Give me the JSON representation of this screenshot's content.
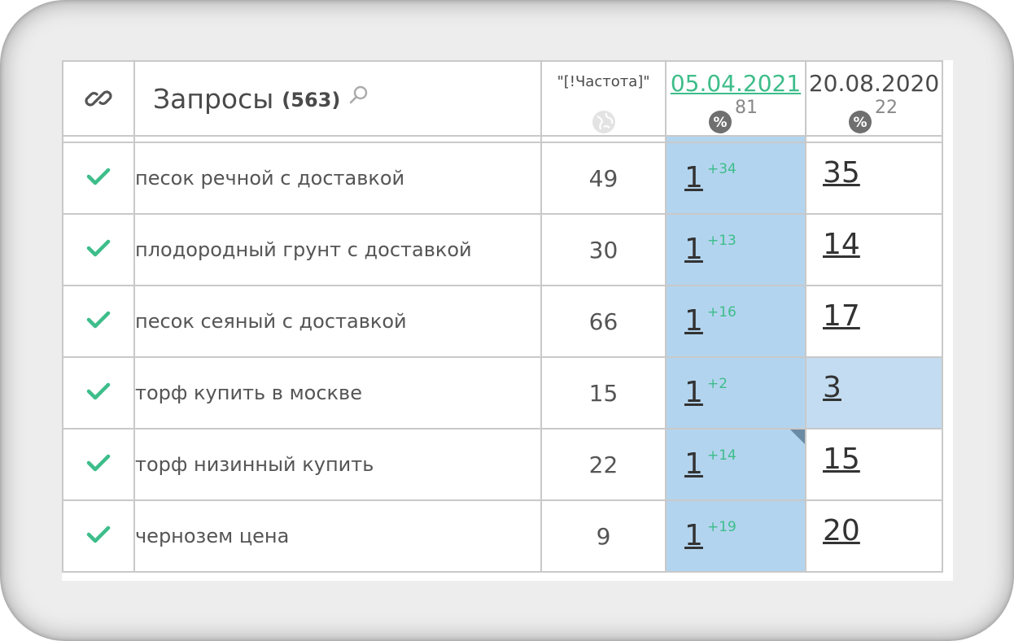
{
  "header": {
    "queries_title": "Запросы",
    "queries_count": "(563)",
    "frequency_label": "\"[!Частота]\"",
    "dates": [
      {
        "label": "05.04.2021",
        "percent": "81",
        "active": true
      },
      {
        "label": "20.08.2020",
        "percent": "22",
        "active": false
      }
    ]
  },
  "rows": [
    {
      "query": "песок речной с доставкой",
      "freq": "49",
      "pos1": "1",
      "delta": "+34",
      "pos2": "35"
    },
    {
      "query": "плодородный грунт с доставкой",
      "freq": "30",
      "pos1": "1",
      "delta": "+13",
      "pos2": "14"
    },
    {
      "query": "песок сеяный с доставкой",
      "freq": "66",
      "pos1": "1",
      "delta": "+16",
      "pos2": "17"
    },
    {
      "query": "торф купить в москве",
      "freq": "15",
      "pos1": "1",
      "delta": "+2",
      "pos2": "3"
    },
    {
      "query": "торф низинный купить",
      "freq": "22",
      "pos1": "1",
      "delta": "+14",
      "pos2": "15"
    },
    {
      "query": "чернозем цена",
      "freq": "9",
      "pos1": "1",
      "delta": "+19",
      "pos2": "20"
    }
  ],
  "icons": {
    "link": "link-icon",
    "search": "search-icon",
    "globe": "globe-icon",
    "percent": "percent-icon",
    "check": "check-icon"
  },
  "colors": {
    "accent_green": "#3dbd8a",
    "highlight_blue": "#b3d4ee",
    "border": "#c9c9c9"
  }
}
